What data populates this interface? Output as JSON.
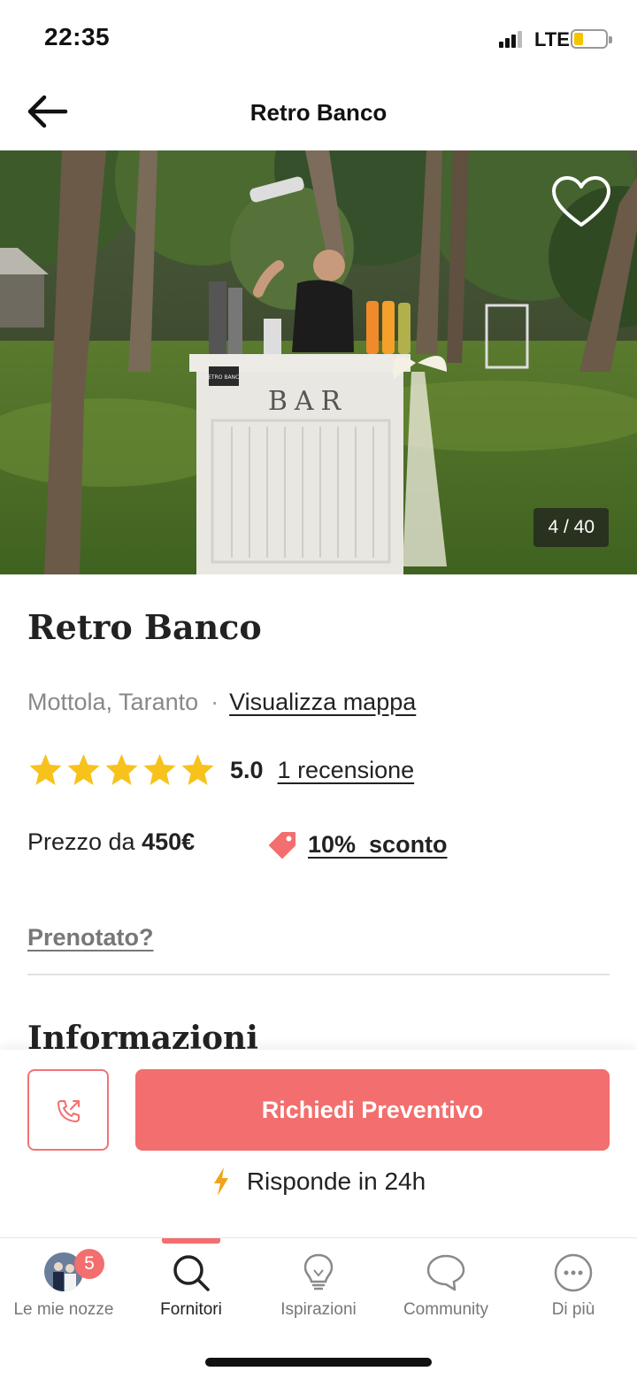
{
  "status_bar": {
    "time": "22:35",
    "network": "LTE",
    "signal_bars": 3,
    "battery_level": 0.3,
    "battery_color": "#f5c400"
  },
  "header": {
    "title": "Retro Banco",
    "back_icon": "arrow-left-icon"
  },
  "gallery": {
    "counter": "4 / 40",
    "favorite_icon": "heart-outline-icon",
    "sign_text": "BAR",
    "chalkboard_text": "RETRO BANCO"
  },
  "vendor": {
    "name": "Retro Banco",
    "location": "Mottola, Taranto",
    "separator": "·",
    "map_link": "Visualizza mappa",
    "rating": "5.0",
    "stars": 5,
    "star_color": "#f8c21c",
    "reviews_link": "1 recensione",
    "price_prefix": "Prezzo da",
    "price_value": "450€",
    "discount_icon": "tag-icon",
    "discount_text": "10%  sconto",
    "booked_link": "Prenotato?",
    "section_heading": "Informazioni"
  },
  "actions": {
    "call_icon": "phone-call-icon",
    "quote_button": "Richiedi Preventivo",
    "response_icon": "lightning-icon",
    "response_text": "Risponde in 24h",
    "accent_color": "#f36e6e"
  },
  "tabs": [
    {
      "label": "Le mie nozze",
      "icon": "avatar-icon",
      "badge": "5",
      "active": false
    },
    {
      "label": "Fornitori",
      "icon": "search-icon",
      "active": true
    },
    {
      "label": "Ispirazioni",
      "icon": "lightbulb-icon",
      "active": false
    },
    {
      "label": "Community",
      "icon": "chat-bubble-icon",
      "active": false
    },
    {
      "label": "Di più",
      "icon": "more-icon",
      "active": false
    }
  ]
}
